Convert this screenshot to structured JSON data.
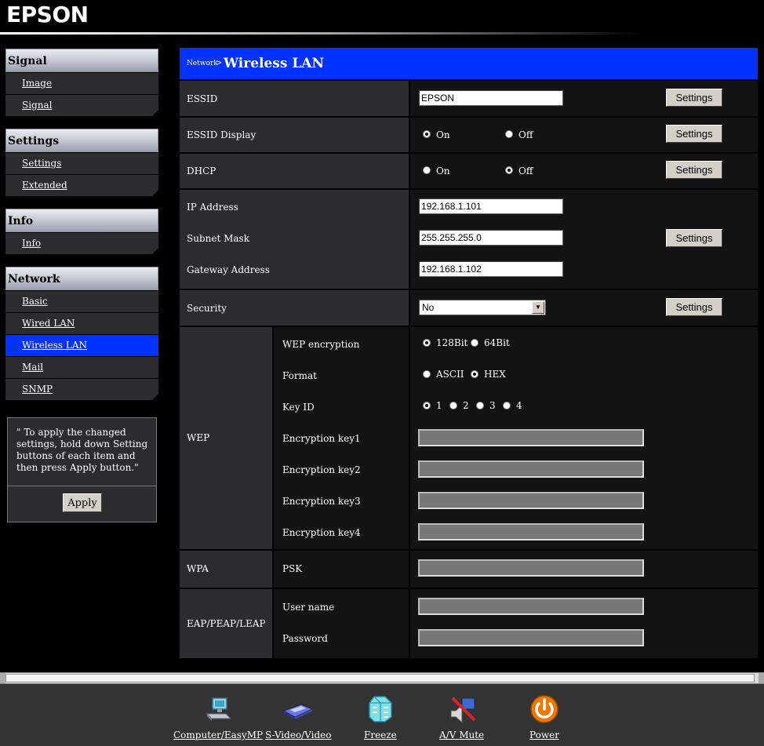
{
  "brand": "EPSON",
  "sidebar": {
    "groups": [
      {
        "title": "Signal",
        "items": [
          "Image",
          "Signal"
        ]
      },
      {
        "title": "Settings",
        "items": [
          "Settings",
          "Extended"
        ]
      },
      {
        "title": "Info",
        "items": [
          "Info"
        ]
      },
      {
        "title": "Network",
        "items": [
          "Basic",
          "Wired LAN",
          "Wireless LAN",
          "Mail",
          "SNMP"
        ]
      }
    ],
    "active_item": "Wireless LAN",
    "note": "\" To apply the changed settings, hold down Setting buttons of each item and then press Apply button.\"",
    "apply_label": "Apply"
  },
  "header": {
    "breadcrumb": "Network",
    "separator": ">",
    "title": "Wireless LAN"
  },
  "settings_label": "Settings",
  "essid": {
    "label": "ESSID",
    "value": "EPSON"
  },
  "essid_display": {
    "label": "ESSID Display",
    "options": [
      "On",
      "Off"
    ],
    "selected": "On"
  },
  "dhcp": {
    "label": "DHCP",
    "options": [
      "On",
      "Off"
    ],
    "selected": "Off"
  },
  "ip": {
    "ip_label": "IP Address",
    "ip_value": "192.168.1.101",
    "mask_label": "Subnet Mask",
    "mask_value": "255.255.255.0",
    "gateway_label": "Gateway Address",
    "gateway_value": "192.168.1.102"
  },
  "security": {
    "label": "Security",
    "selected": "No"
  },
  "wep": {
    "group_label": "WEP",
    "encryption_label": "WEP encryption",
    "encryption_options": [
      "128Bit",
      "64Bit"
    ],
    "encryption_selected": "128Bit",
    "format_label": "Format",
    "format_options": [
      "ASCII",
      "HEX"
    ],
    "format_selected": "HEX",
    "keyid_label": "Key ID",
    "keyid_options": [
      "1",
      "2",
      "3",
      "4"
    ],
    "keyid_selected": "1",
    "key1_label": "Encryption key1",
    "key2_label": "Encryption key2",
    "key3_label": "Encryption key3",
    "key4_label": "Encryption key4"
  },
  "wpa": {
    "group_label": "WPA",
    "psk_label": "PSK"
  },
  "eap": {
    "group_label": "EAP/PEAP/LEAP",
    "username_label": "User name",
    "password_label": "Password"
  },
  "bottom_bar": {
    "items": [
      "Computer/EasyMP",
      "S-Video/Video",
      "Freeze",
      "A/V Mute",
      "Power"
    ]
  },
  "colors": {
    "accent_blue": "#0033ff",
    "panel_dark": "#2c2c2e",
    "panel_black": "#131313",
    "power_orange": "#f07800"
  }
}
